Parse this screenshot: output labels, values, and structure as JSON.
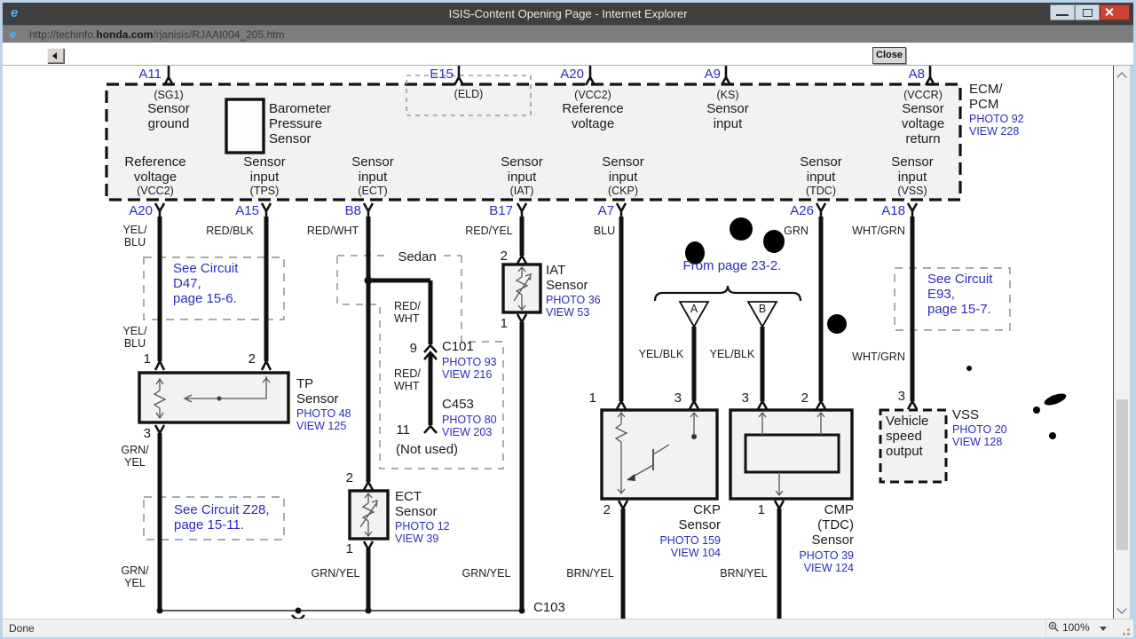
{
  "window": {
    "title": "ISIS-Content Opening Page - Internet Explorer",
    "url_prefix": "http://techinfo.",
    "url_domain": "honda.com",
    "url_path": "/rjanisis/RJAAI004_205.htm",
    "close_button": "Close",
    "status": "Done",
    "zoom_level": "100%"
  },
  "colors": {
    "link_blue": "#2b2bc4",
    "titlebar_gray": "#3f3f3f",
    "close_red": "#ce4233",
    "diagram_fill": "#f2f2f2",
    "frame_blue": "#bcd3ea"
  },
  "ecm": {
    "name": "ECM/\nPCM",
    "photo": "PHOTO 92",
    "view": "VIEW 228",
    "pins_top": [
      "A11",
      "E15",
      "A20",
      "A9",
      "A8"
    ],
    "pins_bottom": [
      "A20",
      "A15",
      "B8",
      "B17",
      "A7",
      "A26",
      "A18"
    ],
    "sg1_sub": "(SG1)",
    "sg1": "Sensor\nground",
    "baro": "Barometer\nPressure\nSensor",
    "eld_sub": "(ELD)",
    "vcc2_sub": "(VCC2)",
    "vcc2": "Reference\nvoltage",
    "ks_sub": "(KS)",
    "ks": "Sensor\ninput",
    "vccr_sub": "(VCCR)",
    "vccr": "Sensor\nvoltage\nreturn",
    "b_vcc2": "Reference\nvoltage",
    "b_vcc2_sub": "(VCC2)",
    "b_tps": "Sensor\ninput",
    "b_tps_sub": "(TPS)",
    "b_ect": "Sensor\ninput",
    "b_ect_sub": "(ECT)",
    "b_iat": "Sensor\ninput",
    "b_iat_sub": "(IAT)",
    "b_ckp": "Sensor\ninput",
    "b_ckp_sub": "(CKP)",
    "b_tdc": "Sensor\ninput",
    "b_tdc_sub": "(TDC)",
    "b_vss": "Sensor\ninput",
    "b_vss_sub": "(VSS)"
  },
  "wire_colors": {
    "a20_top": "YEL/\nBLU",
    "a15": "RED/BLK",
    "b8": "RED/WHT",
    "b17": "RED/YEL",
    "a7": "BLU",
    "a26": "GRN",
    "a18": "WHT/GRN",
    "a20_mid": "YEL/\nBLU",
    "tp_out": "GRN/\nYEL",
    "tp_bottom": "GRN/\nYEL",
    "sedan_1": "RED/\nWHT",
    "sedan_2": "RED/\nWHT",
    "ect_bottom": "GRN/YEL",
    "iat_bottom": "GRN/YEL",
    "branch_a": "YEL/BLK",
    "branch_b": "YEL/BLK",
    "a18_mid": "WHT/GRN",
    "ckp_bottom": "BRN/YEL",
    "cmp_bottom": "BRN/YEL"
  },
  "components": {
    "tp": {
      "name": "TP\nSensor",
      "photo": "PHOTO 48",
      "view": "VIEW 125",
      "pin1": "1",
      "pin2": "2",
      "pin3": "3"
    },
    "ect": {
      "name": "ECT\nSensor",
      "photo": "PHOTO 12",
      "view": "VIEW 39",
      "pin2": "2",
      "pin1": "1"
    },
    "iat": {
      "name": "IAT\nSensor",
      "photo": "PHOTO 36",
      "view": "VIEW 53",
      "pin2": "2",
      "pin1": "1"
    },
    "ckp": {
      "name": "CKP\nSensor",
      "photo": "PHOTO 159",
      "view": "VIEW 104",
      "pin1": "1",
      "pin3": "3",
      "pin2": "2"
    },
    "cmp": {
      "name": "CMP\n(TDC)\nSensor",
      "photo": "PHOTO 39",
      "view": "VIEW 124",
      "pin3": "3",
      "pin2": "2",
      "pin1": "1"
    },
    "vss": {
      "name": "VSS",
      "photo": "PHOTO 20",
      "view": "VIEW 128",
      "box": "Vehicle\nspeed\noutput",
      "pin3": "3"
    }
  },
  "connectors": {
    "c101": {
      "pin": "9",
      "name": "C101",
      "photo": "PHOTO 93",
      "view": "VIEW 216"
    },
    "c453": {
      "pin": "11",
      "name": "C453",
      "photo": "PHOTO 80",
      "view": "VIEW 203"
    },
    "not_used": "(Not used)",
    "c103": "C103"
  },
  "notes": {
    "sedan": "Sedan",
    "from_page": "From page 23-2.",
    "branch_a": "A",
    "branch_b": "B",
    "d47": "See Circuit\nD47,\npage 15-6.",
    "z28": "See Circuit Z28,\npage 15-11.",
    "e93": "See Circuit\nE93,\npage 15-7."
  }
}
